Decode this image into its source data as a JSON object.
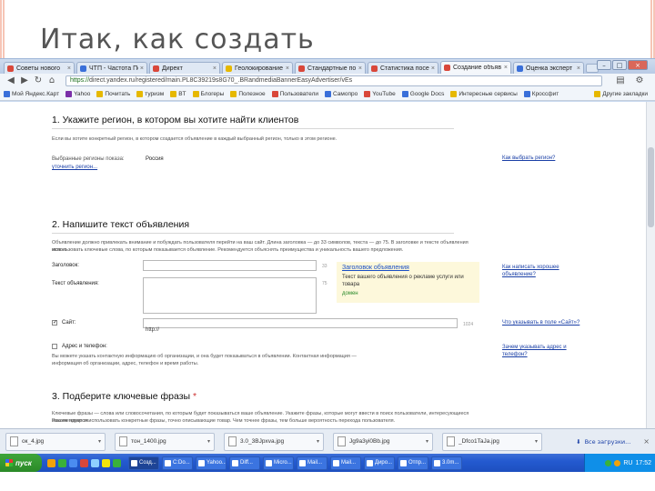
{
  "slide": {
    "title": "Итак, как создать"
  },
  "browser": {
    "tabs": [
      {
        "label": "Советы нового",
        "color": "#d9473a"
      },
      {
        "label": "ЧТП - Частота Пого",
        "color": "#3a6fd9"
      },
      {
        "label": "Директ",
        "color": "#d9473a"
      },
      {
        "label": "Геолокирование",
        "color": "#e6b800"
      },
      {
        "label": "Стандартные по р",
        "color": "#d9473a"
      },
      {
        "label": "Статистика посе",
        "color": "#d9473a"
      },
      {
        "label": "Создание объяв",
        "color": "#d9473a",
        "active": true
      },
      {
        "label": "Оценка эксперт",
        "color": "#3a6fd9"
      }
    ],
    "window_controls": [
      "–",
      "□",
      "×"
    ],
    "url_https": "https://",
    "url_rest": "direct.yandex.ru/registered/main.PL8C39219s8G70_.BRandmediaBannerEasyAdvertiser/vEs",
    "nav_icons": [
      "back-icon",
      "forward-icon",
      "reload-icon",
      "home-icon"
    ],
    "bookmarks": [
      {
        "label": "Мой Яндекс.Карт",
        "color": "#3a6fd9"
      },
      {
        "label": "Yahoo",
        "color": "#7b2fa8"
      },
      {
        "label": "Почитать",
        "color": "#e6b800"
      },
      {
        "label": "туризм",
        "color": "#e6b800"
      },
      {
        "label": "BT",
        "color": "#e6b800"
      },
      {
        "label": "Блогеры",
        "color": "#e6b800"
      },
      {
        "label": "Полезное",
        "color": "#e6b800"
      },
      {
        "label": "Пользователи",
        "color": "#d9473a"
      },
      {
        "label": "Самопро",
        "color": "#3a6fd9"
      },
      {
        "label": "YouTube",
        "color": "#d9473a"
      },
      {
        "label": "Google Docs",
        "color": "#3a6fd9"
      },
      {
        "label": "Интересные сервисы",
        "color": "#e6b800"
      },
      {
        "label": "Кроссфит",
        "color": "#3a6fd9"
      }
    ],
    "bookmarks_other": "Другие закладки"
  },
  "form": {
    "section1": {
      "title": "1. Укажите регион, в котором вы хотите найти клиентов",
      "desc": "Если вы хотите конкретный регион, в котором создается объявление в каждый выбранный регион, только в этом регионе.",
      "regions_label": "Выбранные регионы показа:",
      "regions_value": "Россия",
      "change_link": "уточнить регион...",
      "help_link": "Как выбрать регион?"
    },
    "section2": {
      "title": "2. Напишите текст объявления",
      "desc_line1": "Объявление должно привлекать внимание и побуждать пользователя перейти на ваш сайт. Длина заголовка — до 33 символов, текста — до 75. В заголовке и тексте объявления можно",
      "desc_line2": "использовать ключевые слова, по которым показывается объявление. Рекомендуется объяснять преимущества и уникальность вашего предложения.",
      "title_label": "Заголовок:",
      "title_counter": "33",
      "text_label": "Текст объявления:",
      "text_counter": "75",
      "site_label": "Сайт:",
      "site_value": "http://",
      "site_counter": "1024",
      "title_help": "Как написать хорошее объявление?",
      "site_help": "Что указывать в поле «Сайт»?",
      "preview": {
        "title": "Заголовок объявления",
        "text": "Текст вашего объявления о рекламе услуги или товара",
        "domain": "домен"
      },
      "address_label": "Адрес и телефон:",
      "address_desc_line1": "Вы можете указать контактную информацию об организации, и она будет показываться в объявлении. Контактная информация —",
      "address_desc_line2": "информация об организации, адрес, телефон и время работы.",
      "address_help": "Зачем указывать адрес и телефон?"
    },
    "section3": {
      "title": "3. Подберите ключевые фразы",
      "required_mark": "*",
      "desc_line1": "Ключевые фразы — слова или словосочетания, по которым будет показываться ваше объявление. Укажите фразы, которые могут ввести в поиск пользователи, интересующиеся вашим товаром.",
      "desc_line2": "Рекомендуется использовать конкретные фразы, точно описывающие товар. Чем точнее фразы, тем больше вероятность перехода пользователя."
    }
  },
  "downloads": [
    {
      "name": "ок_4.jpg"
    },
    {
      "name": "тон_1400.jpg"
    },
    {
      "name": "3.0_3BJpxva.jpg"
    },
    {
      "name": "Jg9a3yi0Bb.jpg"
    },
    {
      "name": "_Dfco1TaJa.jpg"
    }
  ],
  "downloads_all": "Все загрузки...",
  "taskbar": {
    "start_label": "пуск",
    "quick_colors": [
      "#f2a20b",
      "#3ab13a",
      "#4b8cf0",
      "#d9473a",
      "#8fd0ff",
      "#f2e40b",
      "#3ab13a"
    ],
    "tasks": [
      {
        "label": "Созд...",
        "active": true
      },
      {
        "label": "С:Do..."
      },
      {
        "label": "Yahoo..."
      },
      {
        "label": "Diff..."
      },
      {
        "label": "Micro..."
      },
      {
        "label": "Mail..."
      },
      {
        "label": "Mail..."
      },
      {
        "label": "Диро..."
      },
      {
        "label": "Отпр..."
      },
      {
        "label": "3.0m..."
      }
    ],
    "lang": "RU",
    "clock": "17:52"
  }
}
